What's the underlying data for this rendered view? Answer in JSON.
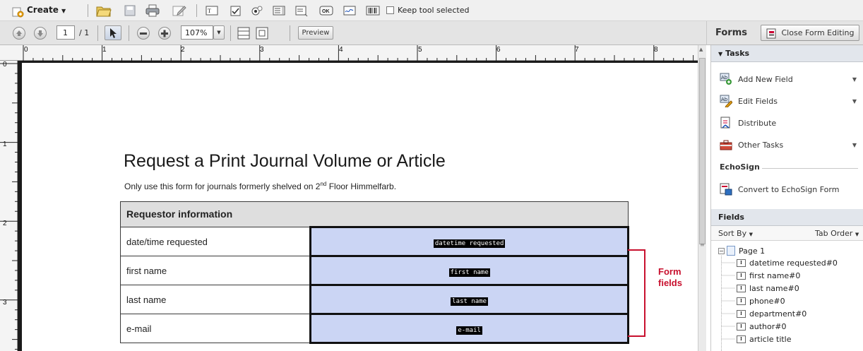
{
  "toolbar": {
    "create_label": "Create",
    "keep_tool_label": "Keep tool selected",
    "page_current": "1",
    "page_total": "/ 1",
    "zoom": "107%",
    "preview_label": "Preview"
  },
  "forms": {
    "title": "Forms",
    "close_label": "Close Form Editing"
  },
  "ruler": {
    "h_labels": [
      "0",
      "1",
      "2",
      "3",
      "4",
      "5",
      "6",
      "7",
      "8"
    ],
    "v_labels": [
      "0",
      "1",
      "2",
      "3"
    ]
  },
  "doc": {
    "title": "Request a Print Journal Volume or Article",
    "subtitle_pre": "Only use this form for journals formerly shelved on 2",
    "subtitle_sup": "nd",
    "subtitle_post": " Floor Himmelfarb.",
    "table_header": "Requestor information",
    "rows": [
      {
        "label": "date/time requested",
        "field": "datetime requested"
      },
      {
        "label": "first name",
        "field": "first name"
      },
      {
        "label": "last name",
        "field": "last name"
      },
      {
        "label": "e-mail",
        "field": "e-mail"
      }
    ],
    "annotation_line1": "Form",
    "annotation_line2": "fields",
    "annotation_color": "#c8102e"
  },
  "tasks": {
    "header": "Tasks",
    "items": [
      "Add New Field",
      "Edit Fields",
      "Distribute",
      "Other Tasks"
    ]
  },
  "echosign": {
    "header": "EchoSign",
    "convert": "Convert to EchoSign Form"
  },
  "fields": {
    "header": "Fields",
    "sort_by": "Sort By",
    "tab_order": "Tab Order",
    "page": "Page 1",
    "items": [
      "datetime requested#0",
      "first name#0",
      "last name#0",
      "phone#0",
      "department#0",
      "author#0",
      "article title"
    ]
  }
}
